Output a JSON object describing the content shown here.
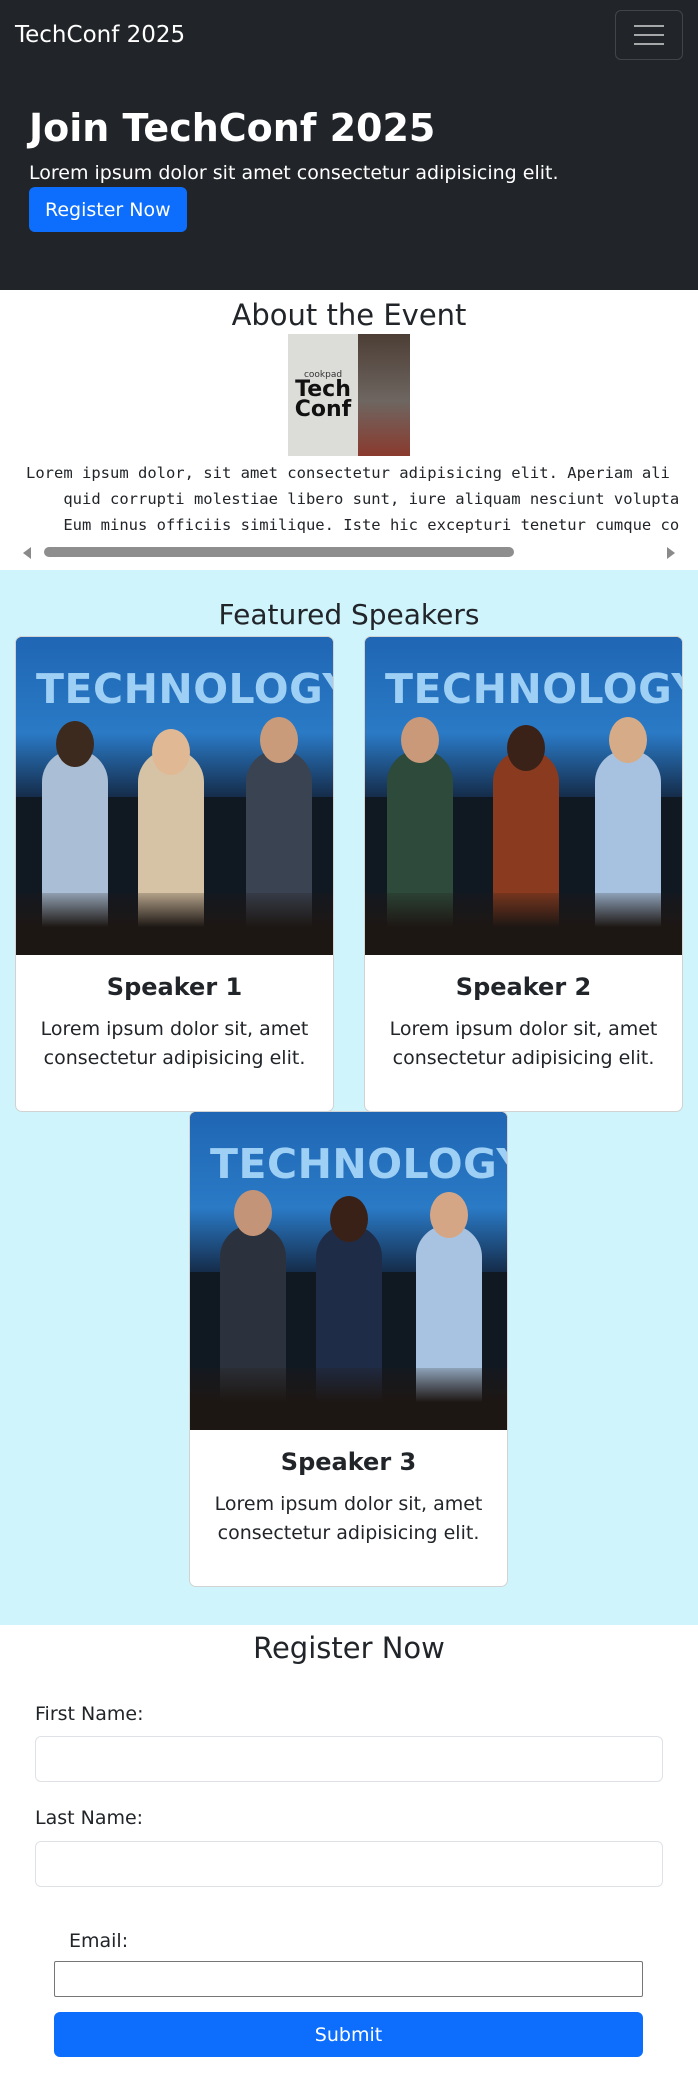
{
  "navbar": {
    "brand": "TechConf 2025",
    "menu_icon": "hamburger-icon"
  },
  "hero": {
    "title": "Join TechConf 2025",
    "subtitle": "Lorem ipsum dolor sit amet consectetur adipisicing elit.",
    "cta_label": "Register Now"
  },
  "about": {
    "title": "About the Event",
    "image_text_small": "cookpad",
    "image_text_big_1": "Tech",
    "image_text_big_2": "Conf",
    "code_text": "Lorem ipsum dolor, sit amet consectetur adipisicing elit. Aperiam ali\n    quid corrupti molestiae libero sunt, iure aliquam nesciunt volupta\n    Eum minus officiis similique. Iste hic excepturi tenetur cumque co"
  },
  "speakers": {
    "title": "Featured Speakers",
    "image_banner": "TECHNOLOGY",
    "items": [
      {
        "name": "Speaker 1",
        "bio": "Lorem ipsum dolor sit, amet consectetur adipisicing elit."
      },
      {
        "name": "Speaker 2",
        "bio": "Lorem ipsum dolor sit, amet consectetur adipisicing elit."
      },
      {
        "name": "Speaker 3",
        "bio": "Lorem ipsum dolor sit, amet consectetur adipisicing elit."
      }
    ]
  },
  "register": {
    "title": "Register Now",
    "first_name_label": "First Name:",
    "last_name_label": "Last Name:",
    "email_label": "Email:",
    "first_name_value": "",
    "last_name_value": "",
    "email_value": "",
    "submit_label": "Submit"
  },
  "colors": {
    "dark": "#212529",
    "primary": "#0d6efd",
    "speakers_bg": "#cff4fc"
  }
}
